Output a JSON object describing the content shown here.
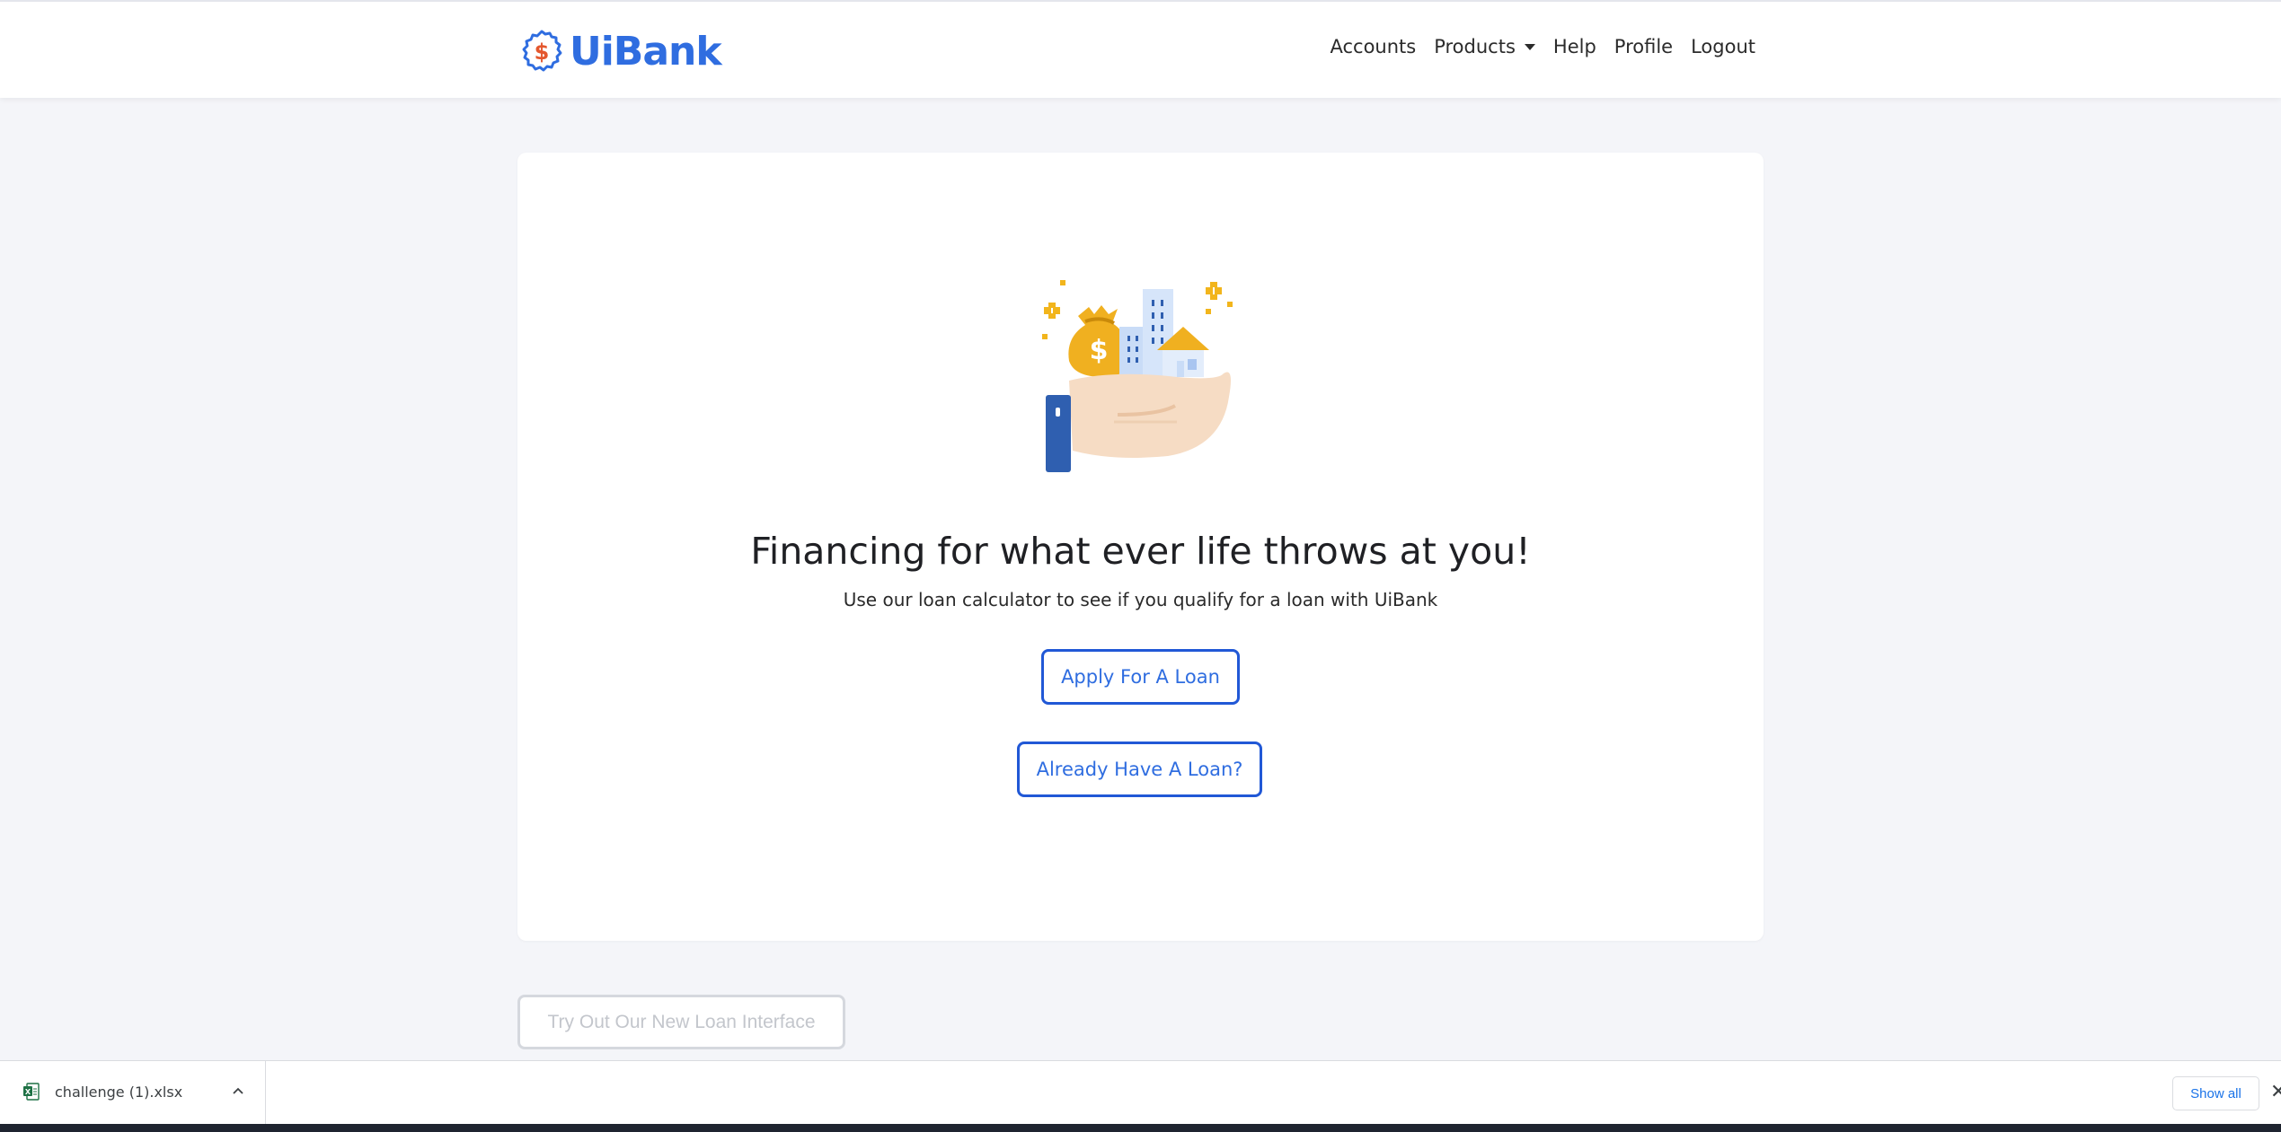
{
  "brand": {
    "name": "UiBank",
    "logo_icon": "dollar-badge-icon",
    "color": "#2f6de0",
    "accent": "#e4572e"
  },
  "nav": {
    "items": [
      {
        "label": "Accounts"
      },
      {
        "label": "Products",
        "dropdown": true
      },
      {
        "label": "Help"
      },
      {
        "label": "Profile"
      },
      {
        "label": "Logout"
      }
    ]
  },
  "hero": {
    "illustration": "hand-holding-money-bag-and-buildings-icon",
    "headline": "Financing for what ever life throws at you!",
    "subtext": "Use our loan calculator to see if you qualify for a loan with UiBank",
    "apply_button": "Apply For A Loan",
    "existing_button": "Already Have A Loan?"
  },
  "secondary": {
    "new_interface_button": "Try Out Our New Loan Interface"
  },
  "downloads": {
    "file_name": "challenge (1).xlsx",
    "file_icon": "excel-file-icon",
    "show_all": "Show all",
    "close_symbol": "✕"
  },
  "colors": {
    "primary_button_border": "#2158d6",
    "page_background": "#f4f5f9",
    "card_background": "#ffffff"
  }
}
